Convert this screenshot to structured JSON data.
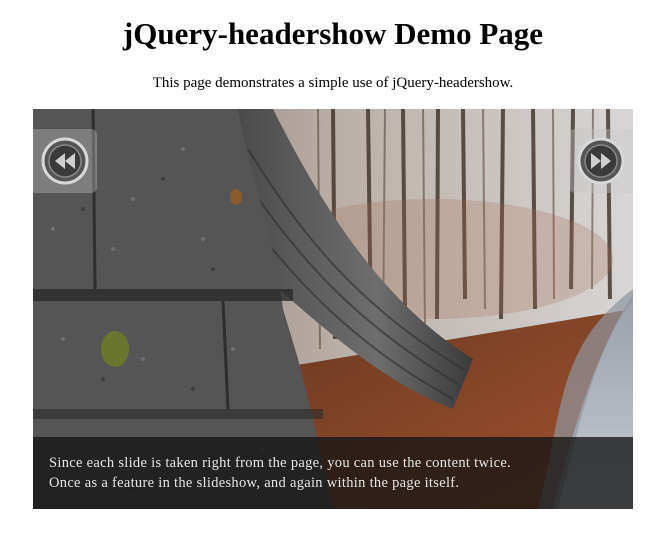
{
  "header": {
    "title": "jQuery-headershow Demo Page",
    "subtitle": "This page demonstrates a simple use of jQuery-headershow."
  },
  "slideshow": {
    "prev_icon": "rewind-icon",
    "next_icon": "fast-forward-icon",
    "caption": {
      "line1": "Since each slide is taken right from the page, you can use the content twice.",
      "line2": "Once as a feature in the slideshow, and again within the page itself."
    }
  }
}
